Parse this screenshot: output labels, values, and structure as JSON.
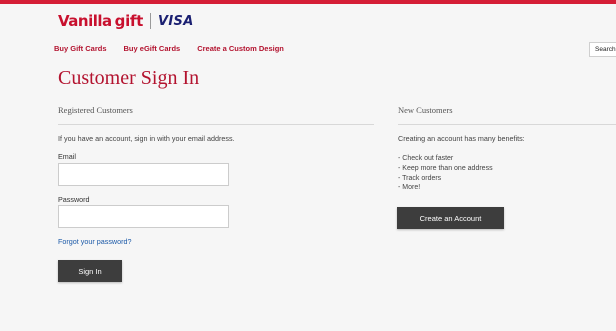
{
  "brand": {
    "name_part1": "Vanilla",
    "name_part2": "gift",
    "partner": "VISA",
    "accent": "#c8102e",
    "partner_color": "#1a1f71"
  },
  "nav": {
    "items": [
      "Buy Gift Cards",
      "Buy eGift Cards",
      "Create a Custom Design"
    ]
  },
  "search": {
    "value": "Search"
  },
  "page": {
    "title": "Customer Sign In"
  },
  "registered": {
    "heading": "Registered Customers",
    "intro": "If you have an account, sign in with your email address.",
    "email_label": "Email",
    "email_value": "",
    "password_label": "Password",
    "password_value": "",
    "forgot_link": "Forgot your password?",
    "sign_in_button": "Sign In"
  },
  "new_customers": {
    "heading": "New Customers",
    "intro": "Creating an account has many benefits:",
    "benefits": [
      "Check out faster",
      "Keep more than one address",
      "Track orders",
      "More!"
    ],
    "create_button": "Create an Account"
  },
  "colors": {
    "top_bar": "#d51e36",
    "link_blue": "#1c5aa8",
    "button_dark": "#3d3d3d",
    "background": "#f6f6f6"
  }
}
